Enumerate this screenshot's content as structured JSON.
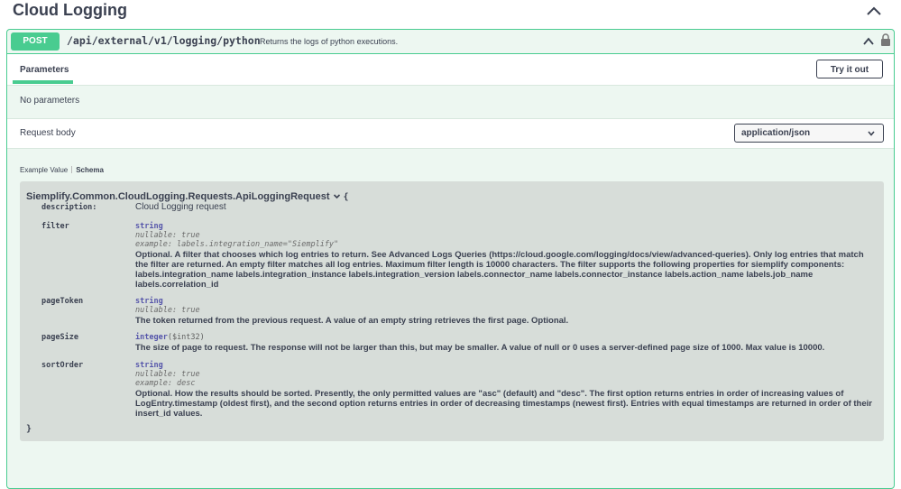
{
  "section": {
    "title": "Cloud Logging"
  },
  "operation": {
    "method": "POST",
    "path": "/api/external/v1/logging/python",
    "summary": "Returns the logs of python executions."
  },
  "tabs": {
    "parameters": "Parameters",
    "try_button": "Try it out"
  },
  "parameters_text": "No parameters",
  "request_body": {
    "label": "Request body",
    "content_type": "application/json"
  },
  "model_tabs": {
    "example": "Example Value",
    "schema": "Schema"
  },
  "schema": {
    "title": "Siemplify.Common.CloudLogging.Requests.ApiLoggingRequest",
    "open_brace": "{",
    "close_brace": "}",
    "description_key": "description:",
    "description_value": "Cloud Logging request",
    "properties": [
      {
        "name": "filter",
        "type": "string",
        "nullable": "nullable: true",
        "example": "example: labels.integration_name=\"Siemplify\"",
        "description": "Optional. A filter that chooses which log entries to return. See Advanced Logs Queries (https://cloud.google.com/logging/docs/view/advanced-queries). Only log entries that match the filter are returned. An empty filter matches all log entries. Maximum filter length is 10000 characters. The filter supports the following properties for siemplify components: labels.integration_name labels.integration_instance labels.integration_version labels.connector_name labels.connector_instance labels.action_name labels.job_name labels.correlation_id"
      },
      {
        "name": "pageToken",
        "type": "string",
        "nullable": "nullable: true",
        "description": "The token returned from the previous request. A value of an empty string retrieves the first page. Optional."
      },
      {
        "name": "pageSize",
        "type": "integer",
        "format": "($int32)",
        "description": "The size of page to request. The response will not be larger than this, but may be smaller. A value of null or 0 uses a server-defined page size of 1000. Max value is 10000."
      },
      {
        "name": "sortOrder",
        "type": "string",
        "nullable": "nullable: true",
        "example": "example: desc",
        "description": "Optional. How the results should be sorted. Presently, the only permitted values are \"asc\" (default) and \"desc\". The first option returns entries in order of increasing values of LogEntry.timestamp (oldest first), and the second option returns entries in order of decreasing timestamps (newest first). Entries with equal timestamps are returned in order of their insert_id values."
      }
    ]
  },
  "colors": {
    "post": "#49cc90",
    "text": "#3b4151",
    "panel": "#edf7f1",
    "model_bg": "#d7ddd9"
  },
  "icons": [
    "chevron-up-icon",
    "lock-icon",
    "chevron-down-icon"
  ]
}
